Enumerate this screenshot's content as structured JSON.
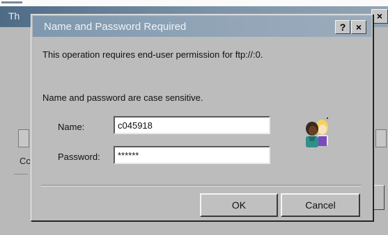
{
  "background_window": {
    "title": "Th",
    "close_label": "×",
    "partial_label": "Cc"
  },
  "dialog": {
    "title": "Name and Password Required",
    "help_label": "?",
    "close_label": "×",
    "message_permission": "This operation requires end-user permission for ftp://:0.",
    "message_case": "Name and password are case sensitive.",
    "name_label": "Name:",
    "name_value": "c045918",
    "password_label": "Password:",
    "password_value": "******",
    "ok_label": "OK",
    "cancel_label": "Cancel",
    "icon": "users-icon"
  },
  "colors": {
    "titlebar_inactive": "#7f98ae",
    "face": "#bcbcbc"
  }
}
